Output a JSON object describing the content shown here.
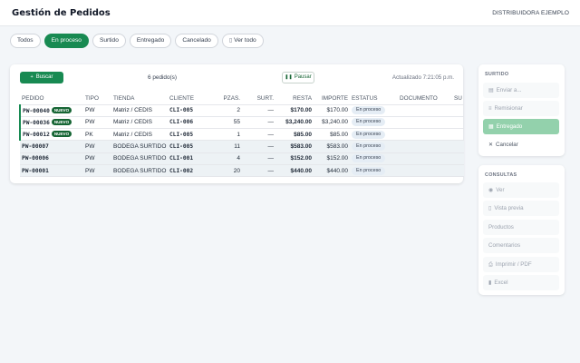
{
  "header": {
    "title": "Gestión de Pedidos",
    "company": "DISTRIBUIDORA EJEMPLO"
  },
  "tabs": [
    {
      "label": "Todos",
      "active": false
    },
    {
      "label": "En proceso",
      "active": true
    },
    {
      "label": "Surtido",
      "active": false
    },
    {
      "label": "Entregado",
      "active": false
    },
    {
      "label": "Cancelado",
      "active": false
    },
    {
      "label": "Ver todo",
      "active": false,
      "icon": "document-icon"
    }
  ],
  "toolbar": {
    "search_label": "Buscar",
    "search_icon": "plus-icon",
    "count_label": "6 pedido(s)",
    "pause_label": "Pausar",
    "pause_icon": "pause-icon",
    "updated_label": "Actualizado 7:21:05 p.m."
  },
  "table": {
    "columns": [
      "PEDIDO",
      "TIPO",
      "TIENDA",
      "CLIENTE",
      "PZAS.",
      "SURT.",
      "RESTA",
      "IMPORTE",
      "ESTATUS",
      "DOCUMENTO",
      "SU E"
    ],
    "new_badge": "NUEVO",
    "rows": [
      {
        "pedido": "PW-00040",
        "nuevo": true,
        "tipo": "PW",
        "tienda": "Matriz / CEDIS",
        "cliente": "CLI-005",
        "pzas": "2",
        "surt": "—",
        "resta": "$170.00",
        "importe": "$170.00",
        "estatus": "En proceso"
      },
      {
        "pedido": "PW-00036",
        "nuevo": true,
        "tipo": "PW",
        "tienda": "Matriz / CEDIS",
        "cliente": "CLI-006",
        "pzas": "55",
        "surt": "—",
        "resta": "$3,240.00",
        "importe": "$3,240.00",
        "estatus": "En proceso"
      },
      {
        "pedido": "PW-00012",
        "nuevo": true,
        "tipo": "PK",
        "tienda": "Matriz / CEDIS",
        "cliente": "CLI-005",
        "pzas": "1",
        "surt": "—",
        "resta": "$85.00",
        "importe": "$85.00",
        "estatus": "En proceso"
      },
      {
        "pedido": "PW-00007",
        "nuevo": false,
        "tipo": "PW",
        "tienda": "BODEGA SURTIDO",
        "cliente": "CLI-005",
        "pzas": "11",
        "surt": "—",
        "resta": "$583.00",
        "importe": "$583.00",
        "estatus": "En proceso"
      },
      {
        "pedido": "PW-00006",
        "nuevo": false,
        "tipo": "PW",
        "tienda": "BODEGA SURTIDO",
        "cliente": "CLI-001",
        "pzas": "4",
        "surt": "—",
        "resta": "$152.00",
        "importe": "$152.00",
        "estatus": "En proceso"
      },
      {
        "pedido": "PW-00001",
        "nuevo": false,
        "tipo": "PW",
        "tienda": "BODEGA SURTIDO",
        "cliente": "CLI-002",
        "pzas": "20",
        "surt": "—",
        "resta": "$440.00",
        "importe": "$440.00",
        "estatus": "En proceso"
      }
    ]
  },
  "surtido": {
    "title": "SURTIDO",
    "items": [
      {
        "label": "Enviar a...",
        "icon": "document-icon"
      },
      {
        "label": "Remisionar",
        "icon": "list-icon"
      },
      {
        "label": "Entregado",
        "icon": "calendar-icon"
      },
      {
        "label": "Cancelar",
        "icon": "close-icon"
      }
    ]
  },
  "consultas": {
    "title": "CONSULTAS",
    "items": [
      {
        "label": "Ver",
        "icon": "eye-icon"
      },
      {
        "label": "Vista previa",
        "icon": "document-icon"
      },
      {
        "label": "Productos"
      },
      {
        "label": "Comentarios"
      },
      {
        "label": "Imprimir / PDF",
        "icon": "printer-icon"
      },
      {
        "label": "Excel",
        "icon": "spreadsheet-icon"
      }
    ]
  },
  "colors": {
    "accent": "#188a52",
    "accent_light": "#93d1ac",
    "row_shade": "#edf2f5"
  }
}
